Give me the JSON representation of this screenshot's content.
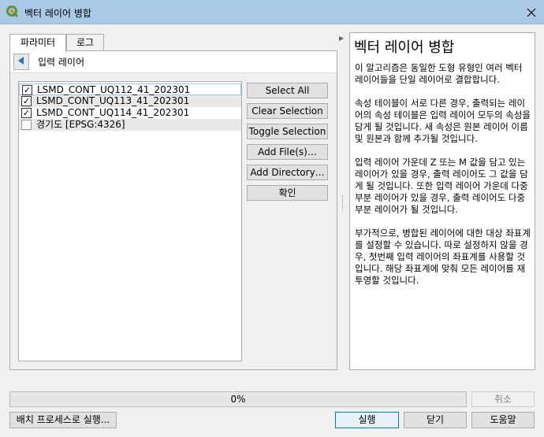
{
  "window": {
    "title": "벡터 레이어 병합",
    "app_icon": "qgis-icon",
    "close_icon": "close-icon"
  },
  "tabs": [
    {
      "label": "파라미터",
      "active": true
    },
    {
      "label": "로그",
      "active": false
    }
  ],
  "input_section": {
    "back_icon": "back-arrow-icon",
    "title": "입력 레이어"
  },
  "layers": [
    {
      "label": "LSMD_CONT_UQ112_41_202301",
      "checked": true
    },
    {
      "label": "LSMD_CONT_UQ113_41_202301",
      "checked": true
    },
    {
      "label": "LSMD_CONT_UQ114_41_202301",
      "checked": true
    },
    {
      "label": "경기도 [EPSG:4326]",
      "checked": false
    }
  ],
  "selection_buttons": {
    "select_all": "Select All",
    "clear_selection": "Clear Selection",
    "toggle_selection": "Toggle Selection",
    "add_files": "Add File(s)…",
    "add_directory": "Add Directory…",
    "ok": "확인"
  },
  "help": {
    "title": "벡터 레이어 병합",
    "paragraphs": [
      "이 알고리즘은 동일한 도형 유형인 여러 벡터 레이어들을 단일 레이어로 결합합니다.",
      "속성 테이블이 서로 다른 경우, 출력되는 레이어의 속성 테이블은 입력 레이어 모두의 속성을 담게 될 것입니다. 새 속성은 원본 레이어 이름 및 원본과 함께 추가될 것입니다.",
      "입력 레이어 가운데 Z 또는 M 값을 담고 있는 레이어가 있을 경우, 출력 레이어도 그 값을 담게 될 것입니다. 또한 입력 레이어 가운데 다중 부분 레이어가 있을 경우, 출력 레이어도 다중 부분 레이어가 될 것입니다.",
      "부가적으로, 병합된 레이어에 대한 대상 좌표계를 설정할 수 있습니다. 따로 설정하지 않을 경우, 첫번째 입력 레이어의 좌표계를 사용할 것입니다. 해당 좌표계에 맞춰 모든 레이어를 재투영할 것입니다."
    ]
  },
  "progress": {
    "value": 0,
    "label": "0%",
    "cancel_label": "취소"
  },
  "footer": {
    "batch_label": "배치 프로세스로 실행...",
    "run_label": "실행",
    "close_label": "닫기",
    "help_label": "도움말"
  },
  "colors": {
    "titlebar": "#a9c9e6",
    "focus_border": "#0078d7",
    "progress_fill": "#06b025"
  }
}
